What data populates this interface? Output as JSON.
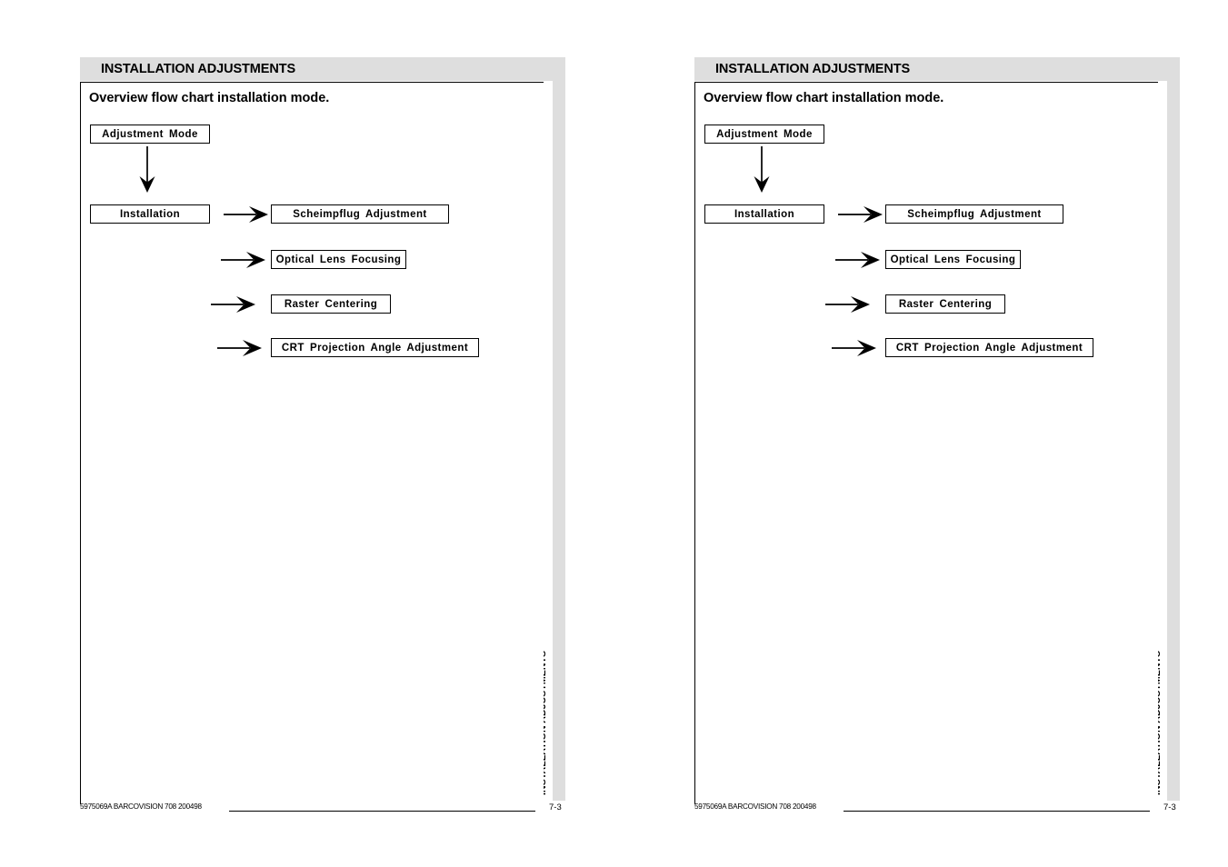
{
  "document": {
    "pages": [
      {
        "header_title": "INSTALLATION ADJUSTMENTS",
        "side_tab_label": "INSTALLATION ADJUSTMENTS",
        "section_heading": "Overview flow chart installation mode.",
        "footer_code": "5975069A BARCOVISION 708 200498",
        "footer_page": "7-3",
        "flow": {
          "nodes": [
            {
              "id": "adjustment-mode",
              "label": "Adjustment  Mode"
            },
            {
              "id": "installation",
              "label": "Installation"
            },
            {
              "id": "scheimpflug-adjustment",
              "label": "Scheimpflug  Adjustment"
            },
            {
              "id": "optical-lens-focusing",
              "label": "Optical  Lens  Focusing"
            },
            {
              "id": "raster-centering",
              "label": "Raster  Centering"
            },
            {
              "id": "crt-projection-angle",
              "label": "CRT  Projection  Angle  Adjustment"
            }
          ]
        }
      },
      {
        "header_title": "INSTALLATION ADJUSTMENTS",
        "side_tab_label": "INSTALLATION ADJUSTMENTS",
        "section_heading": "Overview flow chart installation mode.",
        "footer_code": "5975069A BARCOVISION 708 200498",
        "footer_page": "7-3",
        "flow": {
          "nodes": [
            {
              "id": "adjustment-mode",
              "label": "Adjustment  Mode"
            },
            {
              "id": "installation",
              "label": "Installation"
            },
            {
              "id": "scheimpflug-adjustment",
              "label": "Scheimpflug  Adjustment"
            },
            {
              "id": "optical-lens-focusing",
              "label": "Optical  Lens  Focusing"
            },
            {
              "id": "raster-centering",
              "label": "Raster  Centering"
            },
            {
              "id": "crt-projection-angle",
              "label": "CRT  Projection  Angle  Adjustment"
            }
          ]
        }
      }
    ],
    "colors": {
      "header_gray": "#dedede",
      "ink": "#000000",
      "paper": "#ffffff"
    }
  }
}
